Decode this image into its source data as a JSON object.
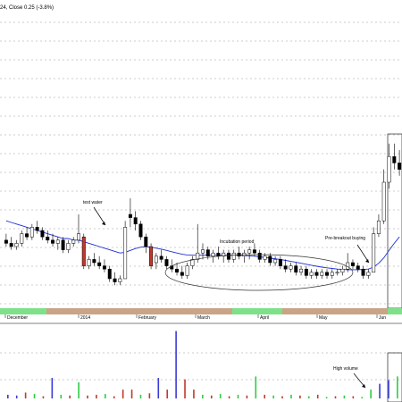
{
  "header": {
    "text": "24, Close 0.25 (-3.8%)"
  },
  "chart_data": {
    "type": "candlestick",
    "x_ticks": [
      "December",
      "2014",
      "February",
      "March",
      "April",
      "May",
      "Jun"
    ],
    "annotations": [
      {
        "text": "test water"
      },
      {
        "text": "Incubation period"
      },
      {
        "text": "Pre-breakout buying"
      },
      {
        "text": "High volume"
      }
    ],
    "colors": {
      "up": "#ffffff",
      "down": "#000000",
      "down_body": "#c0392b",
      "ma": "#1f2fd0",
      "vol_up": "#2ecc40",
      "vol_down": "#c0392b",
      "vol_neutral": "#3a3ad8",
      "timeline_green": "#7fe08a",
      "timeline_tan": "#c9a487",
      "grid": "#9a9a9a"
    },
    "candles": [
      {
        "o": 22,
        "h": 24,
        "l": 20,
        "c": 21
      },
      {
        "o": 21,
        "h": 23,
        "l": 19,
        "c": 20
      },
      {
        "o": 20,
        "h": 22,
        "l": 19,
        "c": 21
      },
      {
        "o": 21,
        "h": 25,
        "l": 20,
        "c": 24
      },
      {
        "o": 24,
        "h": 26,
        "l": 22,
        "c": 23
      },
      {
        "o": 23,
        "h": 27,
        "l": 22,
        "c": 26
      },
      {
        "o": 26,
        "h": 28,
        "l": 24,
        "c": 25
      },
      {
        "o": 25,
        "h": 26,
        "l": 22,
        "c": 23
      },
      {
        "o": 23,
        "h": 25,
        "l": 21,
        "c": 22
      },
      {
        "o": 22,
        "h": 24,
        "l": 20,
        "c": 21
      },
      {
        "o": 21,
        "h": 23,
        "l": 19,
        "c": 22
      },
      {
        "o": 22,
        "h": 23,
        "l": 18,
        "c": 19
      },
      {
        "o": 19,
        "h": 22,
        "l": 18,
        "c": 21
      },
      {
        "o": 21,
        "h": 23,
        "l": 20,
        "c": 22
      },
      {
        "o": 22,
        "h": 30,
        "l": 21,
        "c": 24
      },
      {
        "o": 23,
        "h": 24,
        "l": 13,
        "c": 14
      },
      {
        "o": 14,
        "h": 17,
        "l": 13,
        "c": 16
      },
      {
        "o": 16,
        "h": 18,
        "l": 14,
        "c": 15
      },
      {
        "o": 15,
        "h": 17,
        "l": 13,
        "c": 14
      },
      {
        "o": 14,
        "h": 16,
        "l": 12,
        "c": 13
      },
      {
        "o": 13,
        "h": 14,
        "l": 9,
        "c": 10
      },
      {
        "o": 10,
        "h": 12,
        "l": 8,
        "c": 9
      },
      {
        "o": 9,
        "h": 11,
        "l": 8,
        "c": 10
      },
      {
        "o": 10,
        "h": 28,
        "l": 10,
        "c": 26
      },
      {
        "o": 30,
        "h": 35,
        "l": 26,
        "c": 29
      },
      {
        "o": 29,
        "h": 31,
        "l": 25,
        "c": 27
      },
      {
        "o": 27,
        "h": 28,
        "l": 22,
        "c": 23
      },
      {
        "o": 23,
        "h": 24,
        "l": 18,
        "c": 20
      },
      {
        "o": 20,
        "h": 21,
        "l": 13,
        "c": 14
      },
      {
        "o": 15,
        "h": 18,
        "l": 13,
        "c": 17
      },
      {
        "o": 17,
        "h": 19,
        "l": 15,
        "c": 16
      },
      {
        "o": 16,
        "h": 17,
        "l": 13,
        "c": 14
      },
      {
        "o": 14,
        "h": 16,
        "l": 12,
        "c": 13
      },
      {
        "o": 13,
        "h": 15,
        "l": 11,
        "c": 12
      },
      {
        "o": 12,
        "h": 14,
        "l": 10,
        "c": 11
      },
      {
        "o": 11,
        "h": 15,
        "l": 10,
        "c": 14
      },
      {
        "o": 14,
        "h": 17,
        "l": 13,
        "c": 16
      },
      {
        "o": 16,
        "h": 27,
        "l": 15,
        "c": 18
      },
      {
        "o": 18,
        "h": 21,
        "l": 16,
        "c": 19
      },
      {
        "o": 19,
        "h": 20,
        "l": 16,
        "c": 17
      },
      {
        "o": 17,
        "h": 19,
        "l": 15,
        "c": 18
      },
      {
        "o": 18,
        "h": 20,
        "l": 16,
        "c": 17
      },
      {
        "o": 17,
        "h": 19,
        "l": 15,
        "c": 18
      },
      {
        "o": 18,
        "h": 19,
        "l": 15,
        "c": 16
      },
      {
        "o": 16,
        "h": 19,
        "l": 15,
        "c": 18
      },
      {
        "o": 18,
        "h": 20,
        "l": 16,
        "c": 17
      },
      {
        "o": 17,
        "h": 19,
        "l": 15,
        "c": 18
      },
      {
        "o": 18,
        "h": 20,
        "l": 16,
        "c": 19
      },
      {
        "o": 19,
        "h": 21,
        "l": 17,
        "c": 18
      },
      {
        "o": 18,
        "h": 19,
        "l": 15,
        "c": 16
      },
      {
        "o": 16,
        "h": 18,
        "l": 15,
        "c": 17
      },
      {
        "o": 17,
        "h": 18,
        "l": 14,
        "c": 15
      },
      {
        "o": 15,
        "h": 17,
        "l": 14,
        "c": 16
      },
      {
        "o": 16,
        "h": 17,
        "l": 13,
        "c": 14
      },
      {
        "o": 14,
        "h": 16,
        "l": 12,
        "c": 13
      },
      {
        "o": 13,
        "h": 15,
        "l": 12,
        "c": 14
      },
      {
        "o": 14,
        "h": 15,
        "l": 11,
        "c": 12
      },
      {
        "o": 12,
        "h": 14,
        "l": 11,
        "c": 13
      },
      {
        "o": 13,
        "h": 14,
        "l": 10,
        "c": 11
      },
      {
        "o": 11,
        "h": 13,
        "l": 10,
        "c": 12
      },
      {
        "o": 12,
        "h": 13,
        "l": 10,
        "c": 11
      },
      {
        "o": 11,
        "h": 13,
        "l": 10,
        "c": 12
      },
      {
        "o": 12,
        "h": 13,
        "l": 10,
        "c": 11
      },
      {
        "o": 11,
        "h": 13,
        "l": 10,
        "c": 12
      },
      {
        "o": 12,
        "h": 13,
        "l": 11,
        "c": 12
      },
      {
        "o": 12,
        "h": 14,
        "l": 11,
        "c": 13
      },
      {
        "o": 13,
        "h": 18,
        "l": 12,
        "c": 15
      },
      {
        "o": 15,
        "h": 16,
        "l": 13,
        "c": 14
      },
      {
        "o": 14,
        "h": 15,
        "l": 12,
        "c": 13
      },
      {
        "o": 13,
        "h": 14,
        "l": 10,
        "c": 11
      },
      {
        "o": 11,
        "h": 13,
        "l": 10,
        "c": 12
      },
      {
        "o": 12,
        "h": 26,
        "l": 12,
        "c": 24
      },
      {
        "o": 24,
        "h": 30,
        "l": 23,
        "c": 28
      },
      {
        "o": 28,
        "h": 44,
        "l": 27,
        "c": 40
      },
      {
        "o": 40,
        "h": 52,
        "l": 38,
        "c": 48
      },
      {
        "o": 48,
        "h": 52,
        "l": 44,
        "c": 46
      },
      {
        "o": 46,
        "h": 50,
        "l": 42,
        "c": 44
      }
    ],
    "ma": [
      28,
      27.5,
      27,
      26.5,
      26,
      25.5,
      25,
      24.5,
      24,
      23.5,
      23,
      22.5,
      22.5,
      22,
      22,
      21.5,
      21,
      20.5,
      20,
      19.5,
      19,
      18.5,
      18,
      18.2,
      18.8,
      19.4,
      19.8,
      20,
      19.8,
      19.5,
      19.2,
      18.8,
      18.4,
      18,
      17.6,
      17.4,
      17.3,
      17.3,
      17.3,
      17.3,
      17.3,
      17.3,
      17.3,
      17.3,
      17.3,
      17.3,
      17.2,
      17.1,
      17,
      16.8,
      16.6,
      16.4,
      16.2,
      16,
      15.7,
      15.4,
      15.1,
      14.8,
      14.5,
      14.2,
      13.9,
      13.6,
      13.4,
      13.2,
      13,
      12.9,
      12.8,
      12.8,
      12.8,
      12.9,
      13,
      13.6,
      14.8,
      16.5,
      18.8,
      21,
      23
    ],
    "volumes": [
      {
        "v": 0.05,
        "c": "neutral"
      },
      {
        "v": 0.04,
        "c": "neutral"
      },
      {
        "v": 0.08,
        "c": "down"
      },
      {
        "v": 0.06,
        "c": "up"
      },
      {
        "v": 0.03,
        "c": "down"
      },
      {
        "v": 0.28,
        "c": "neutral"
      },
      {
        "v": 0.05,
        "c": "up"
      },
      {
        "v": 0.04,
        "c": "down"
      },
      {
        "v": 0.22,
        "c": "up"
      },
      {
        "v": 0.04,
        "c": "down"
      },
      {
        "v": 0.05,
        "c": "down"
      },
      {
        "v": 0.06,
        "c": "up"
      },
      {
        "v": 0.03,
        "c": "down"
      },
      {
        "v": 0.12,
        "c": "down"
      },
      {
        "v": 0.12,
        "c": "down"
      },
      {
        "v": 0.05,
        "c": "up"
      },
      {
        "v": 0.07,
        "c": "down"
      },
      {
        "v": 0.28,
        "c": "neutral"
      },
      {
        "v": 0.12,
        "c": "down"
      },
      {
        "v": 0.92,
        "c": "neutral"
      },
      {
        "v": 0.26,
        "c": "down"
      },
      {
        "v": 0.12,
        "c": "down"
      },
      {
        "v": 0.05,
        "c": "up"
      },
      {
        "v": 0.04,
        "c": "down"
      },
      {
        "v": 0.06,
        "c": "up"
      },
      {
        "v": 0.03,
        "c": "down"
      },
      {
        "v": 0.05,
        "c": "up"
      },
      {
        "v": 0.04,
        "c": "down"
      },
      {
        "v": 0.3,
        "c": "up"
      },
      {
        "v": 0.05,
        "c": "down"
      },
      {
        "v": 0.04,
        "c": "up"
      },
      {
        "v": 0.03,
        "c": "down"
      },
      {
        "v": 0.05,
        "c": "up"
      },
      {
        "v": 0.04,
        "c": "down"
      },
      {
        "v": 0.03,
        "c": "up"
      },
      {
        "v": 0.05,
        "c": "down"
      },
      {
        "v": 0.02,
        "c": "up"
      },
      {
        "v": 0.03,
        "c": "down"
      },
      {
        "v": 0.04,
        "c": "up"
      },
      {
        "v": 0.03,
        "c": "down"
      },
      {
        "v": 0.02,
        "c": "up"
      },
      {
        "v": 0.12,
        "c": "up"
      },
      {
        "v": 0.2,
        "c": "neutral"
      },
      {
        "v": 0.25,
        "c": "neutral"
      },
      {
        "v": 0.3,
        "c": "up"
      }
    ]
  }
}
